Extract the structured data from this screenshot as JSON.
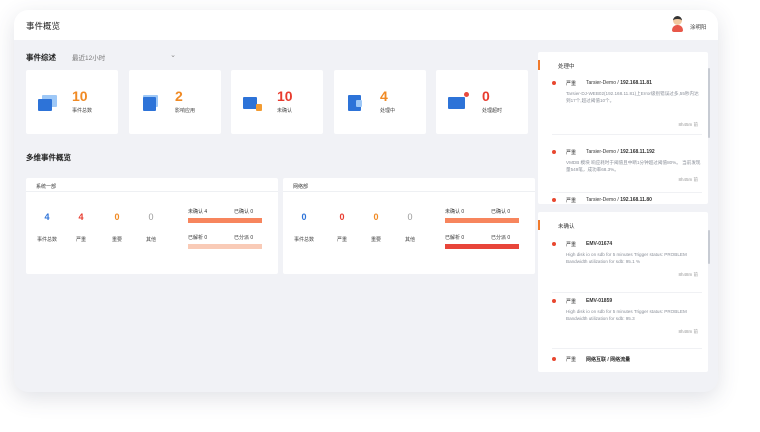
{
  "app": {
    "title": "事件概览",
    "user_name": "涂明阳"
  },
  "overview": {
    "title": "事件综述",
    "time_range": "最近12小时",
    "stats": [
      {
        "value": "10",
        "label": "事件总数",
        "color": "#f08a24"
      },
      {
        "value": "2",
        "label": "影响应用",
        "color": "#f08a24"
      },
      {
        "value": "10",
        "label": "未确认",
        "color": "#e83b2e"
      },
      {
        "value": "4",
        "label": "处理中",
        "color": "#f08a24"
      },
      {
        "value": "0",
        "label": "处理超时",
        "color": "#e83b2e"
      }
    ]
  },
  "multi_dim": {
    "title": "多维事件概览",
    "groups": [
      {
        "name": "系统一部",
        "total": "4",
        "total_label": "事件总数",
        "severe": "4",
        "severe_label": "严重",
        "important": "0",
        "important_label": "重要",
        "other": "0",
        "other_label": "其他",
        "unconfirmed_label": "未确认",
        "unconfirmed": "4",
        "confirmed_label": "已确认",
        "confirmed": "0",
        "resolved_label": "已解析",
        "resolved": "0",
        "assigned_label": "已分派",
        "assigned": "0",
        "bar1_color": "#f7855d",
        "bar2_color": "#f9cbb7"
      },
      {
        "name": "网络部",
        "total": "0",
        "total_label": "事件总数",
        "severe": "0",
        "severe_label": "严重",
        "important": "0",
        "important_label": "重要",
        "other": "0",
        "other_label": "其他",
        "unconfirmed_label": "未确认",
        "unconfirmed": "0",
        "confirmed_label": "已确认",
        "confirmed": "0",
        "resolved_label": "已解析",
        "resolved": "0",
        "assigned_label": "已分派",
        "assigned": "0",
        "bar1_color": "#f7855d",
        "bar2_color": "#e8453a"
      }
    ]
  },
  "processing": {
    "title": "处理中",
    "items": [
      {
        "level": "严重",
        "source": "Tarsier-Demo /",
        "ip": "192.168.11.81",
        "body": "Tarsier-DJ-WEB02(192.168.11.81)上Error级别错误过多,55秒内达到17个,超过阈值10个。",
        "time": "8h45m 前"
      },
      {
        "level": "严重",
        "source": "Tarsier-Demo /",
        "ip": "192.168.11.192",
        "body": "VMDB 模块 响应耗时于阈值且中断1分钟超过阈值80%。 当前发现量549笔，成功率68.3%。",
        "time": "8h45m 前"
      },
      {
        "level": "严重",
        "source": "Tarsier-Demo /",
        "ip": "192.168.11.80",
        "body": "",
        "time": ""
      }
    ]
  },
  "unconfirmed": {
    "title": "未确认",
    "items": [
      {
        "level": "严重",
        "title": "EMV-01674",
        "body": "High disk io on sdb for 5 minutes Trigger status: PROBLEM Bandwidth utilization for sdb: 95.1 %",
        "time": "8h48m 前"
      },
      {
        "level": "严重",
        "title": "EMV-01859",
        "body": "High disk io on sdb for 5 minutes Trigger status: PROBLEM Bandwidth utilization for sdb: 95.3",
        "time": "8h48m 前"
      },
      {
        "level": "严重",
        "title": "网络互联 / 网络流量",
        "body": "",
        "time": ""
      }
    ]
  }
}
